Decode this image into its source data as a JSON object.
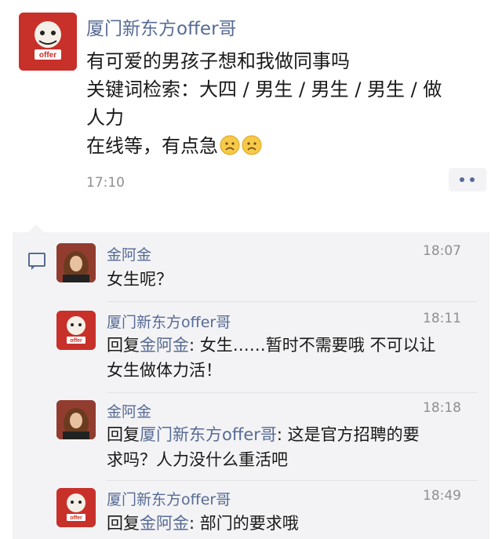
{
  "post": {
    "author": "厦门新东方offer哥",
    "lines": [
      "有可爱的男孩子想和我做同事吗",
      "关键词检索：大四 / 男生 / 男生 / 男生 / 做",
      "人力",
      "在线等，有点急"
    ],
    "time": "17:10",
    "emojis": [
      "sad-face-icon",
      "sad-face-icon"
    ]
  },
  "comments": [
    {
      "author": "金阿金",
      "time": "18:07",
      "reply_prefix": "",
      "reply_to": "",
      "reply_sep": "",
      "lines": [
        "女生呢？"
      ]
    },
    {
      "author": "厦门新东方offer哥",
      "time": "18:11",
      "reply_prefix": "回复",
      "reply_to": "金阿金",
      "reply_sep": ": ",
      "lines": [
        "女生……暂时不需要哦 不可以让",
        "女生做体力活！"
      ]
    },
    {
      "author": "金阿金",
      "time": "18:18",
      "reply_prefix": "回复",
      "reply_to": "厦门新东方offer哥",
      "reply_sep": ": ",
      "lines": [
        "这是官方招聘的要",
        "求吗？人力没什么重活吧"
      ]
    },
    {
      "author": "厦门新东方offer哥",
      "time": "18:49",
      "reply_prefix": "回复",
      "reply_to": "金阿金",
      "reply_sep": ": ",
      "lines": [
        "部门的要求哦"
      ]
    }
  ],
  "avatar_text": {
    "offer_logo": "offer"
  },
  "colors": {
    "link": "#576b95",
    "panel": "#f3f3f5",
    "brand_red": "#c8302a"
  }
}
